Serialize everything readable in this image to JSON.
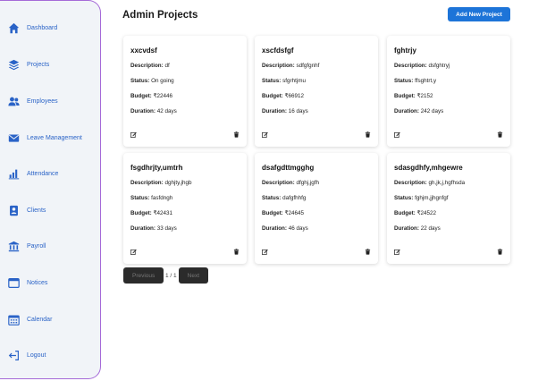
{
  "sidebar": {
    "items": [
      {
        "label": "Dashboard",
        "icon": "home-icon"
      },
      {
        "label": "Projects",
        "icon": "layers-icon"
      },
      {
        "label": "Employees",
        "icon": "users-icon"
      },
      {
        "label": "Leave Management",
        "icon": "envelope-icon"
      },
      {
        "label": "Attendance",
        "icon": "bar-chart-icon"
      },
      {
        "label": "Clients",
        "icon": "id-card-icon"
      },
      {
        "label": "Payroll",
        "icon": "bank-icon"
      },
      {
        "label": "Notices",
        "icon": "window-icon"
      },
      {
        "label": "Calendar",
        "icon": "calendar-icon"
      },
      {
        "label": "Logout",
        "icon": "logout-icon"
      }
    ]
  },
  "header": {
    "title": "Admin Projects",
    "add_label": "Add New Project"
  },
  "labels": {
    "description": "Description:",
    "status": "Status:",
    "budget": "Budget:",
    "duration": "Duration:"
  },
  "projects": [
    {
      "name": "xxcvdsf",
      "description": "df",
      "status": "On going",
      "budget": "₹22446",
      "duration": "42 days"
    },
    {
      "name": "xscfdsfgf",
      "description": "sdfgfgnhf",
      "status": "sfgrhtjmu",
      "budget": "₹66912",
      "duration": "16 days"
    },
    {
      "name": "fghtrjy",
      "description": "dsfghtryj",
      "status": "ffsghtrt,y",
      "budget": "₹2152",
      "duration": "242 days"
    },
    {
      "name": "fsgdhrjty,umtrh",
      "description": "dghjty,jhgb",
      "status": "fasfdngh",
      "budget": "₹42431",
      "duration": "33 days"
    },
    {
      "name": "dsafgdttmgghg",
      "description": "dfghj,jgfh",
      "status": "dafgfhhfg",
      "budget": "₹24645",
      "duration": "46 days"
    },
    {
      "name": "sdasgdhfy,mhgewre",
      "description": "gh,jk,j,hgfhsda",
      "status": "fghjm,jjhgnfgf",
      "budget": "₹24522",
      "duration": "22 days"
    }
  ],
  "pagination": {
    "previous_label": "Previous",
    "info": "1 / 1",
    "next_label": "Next"
  },
  "colors": {
    "accent": "#1d74d8",
    "sidebar_border": "#a56ad8",
    "sidebar_bg": "#f1f4f8"
  }
}
